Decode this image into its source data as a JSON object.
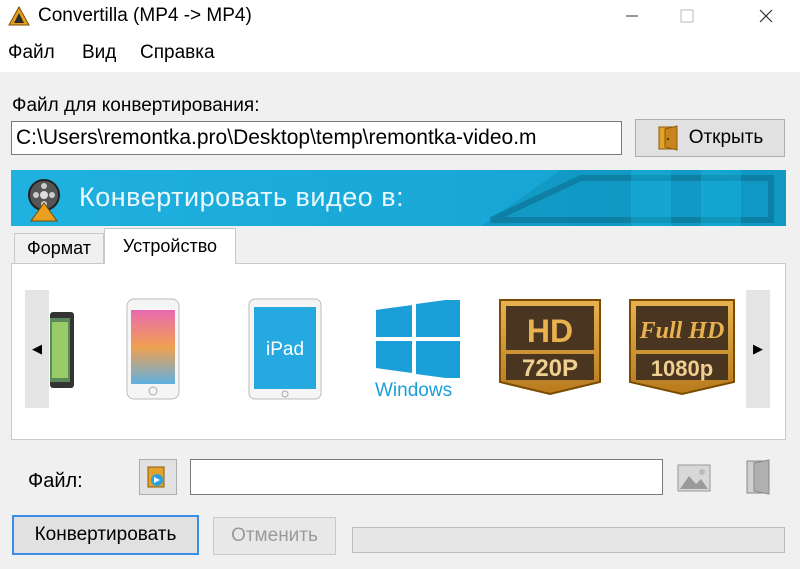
{
  "window": {
    "title": "Convertilla  (MP4 -> MP4)"
  },
  "menu": {
    "items": [
      "Файл",
      "Вид",
      "Справка"
    ]
  },
  "input": {
    "label": "Файл для конвертирования:",
    "path": "C:\\Users\\remontka.pro\\Desktop\\temp\\remontka-video.m",
    "open_label": "Открыть"
  },
  "banner": {
    "text": "Конвертировать видео в:"
  },
  "tabs": [
    {
      "label": "Формат",
      "active": false
    },
    {
      "label": "Устройство",
      "active": true
    }
  ],
  "devices": [
    {
      "name": "android-phone-icon"
    },
    {
      "name": "smartphone-icon"
    },
    {
      "name": "ipad-icon",
      "label": "iPad"
    },
    {
      "name": "windows-icon",
      "label": "Windows"
    },
    {
      "name": "hd-720p-icon",
      "line1": "HD",
      "line2": "720P"
    },
    {
      "name": "full-hd-1080p-icon",
      "line1": "Full HD",
      "line2": "1080p"
    }
  ],
  "output": {
    "label": "Файл:",
    "value": ""
  },
  "actions": {
    "convert_label": "Конвертировать",
    "cancel_label": "Отменить"
  },
  "progress": {
    "value": 0
  },
  "colors": {
    "accent": "#1fb1e0",
    "windows_blue": "#1a9fd8",
    "gold": "#c78a2a"
  }
}
